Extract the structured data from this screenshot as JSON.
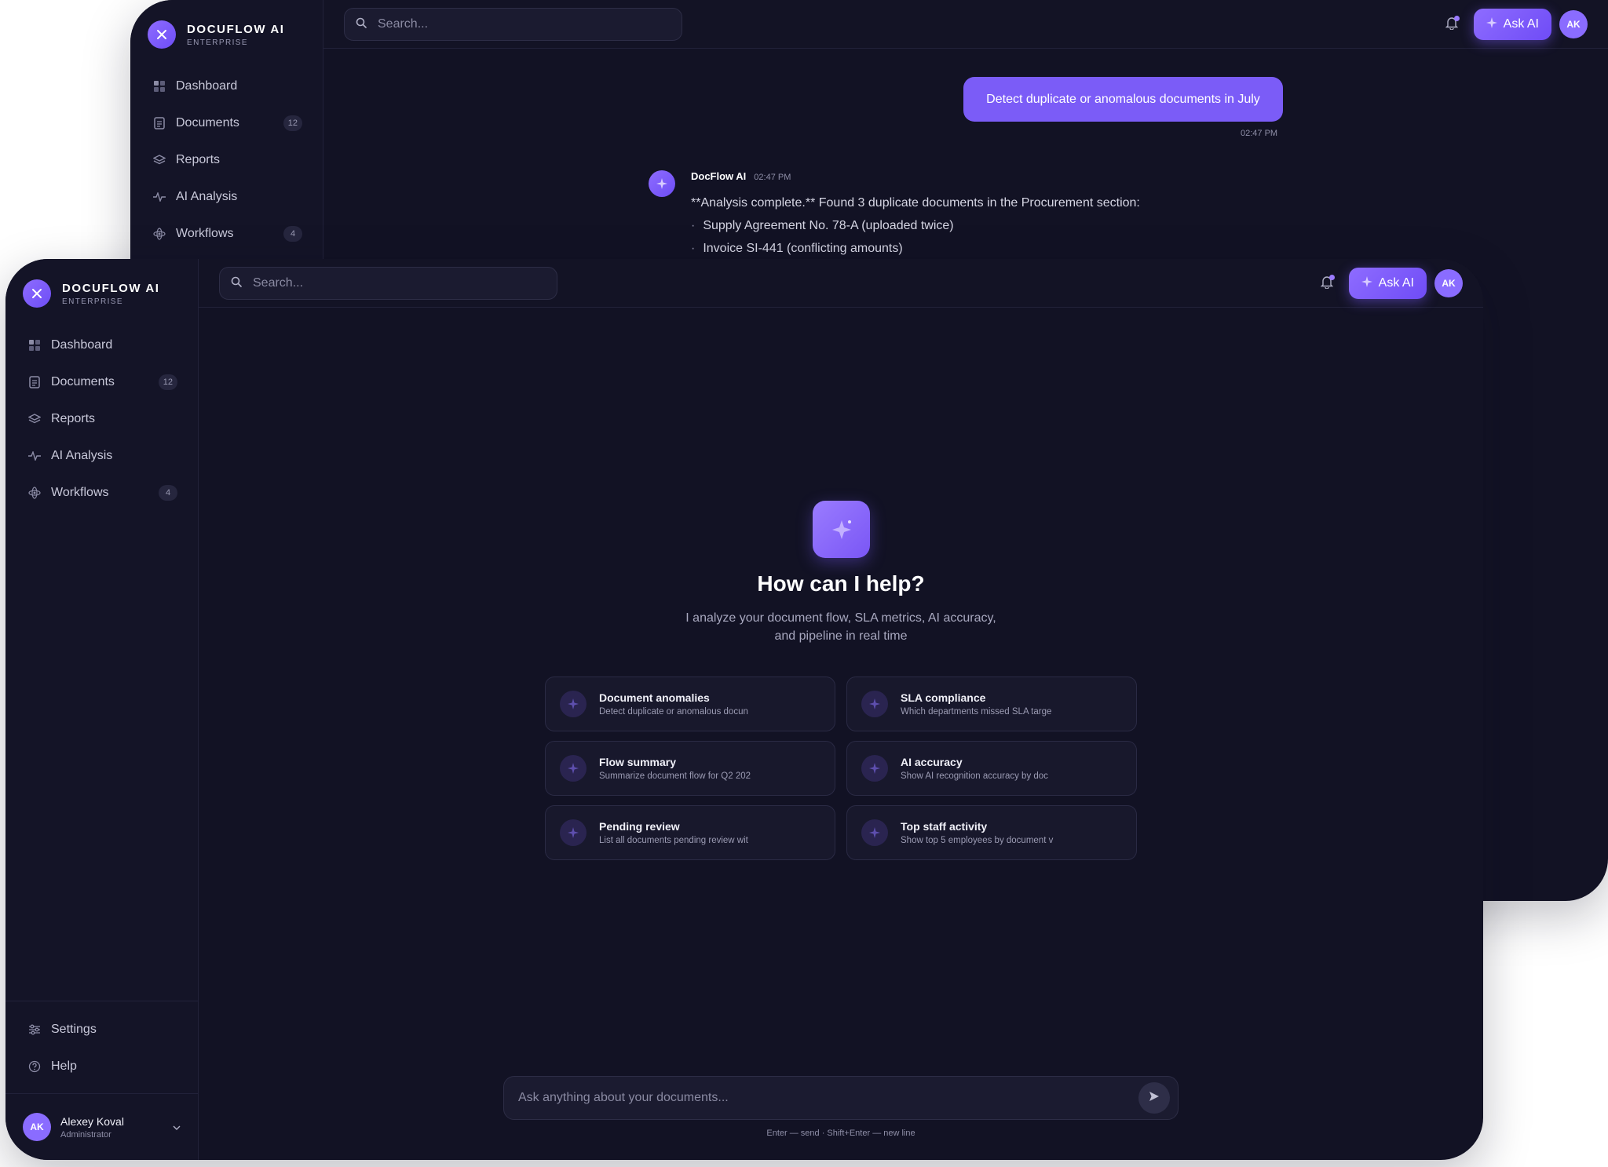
{
  "brand": {
    "name": "DOCUFLOW AI",
    "subtitle": "ENTERPRISE"
  },
  "nav": [
    {
      "label": "Dashboard",
      "icon": "grid-icon",
      "badge": null
    },
    {
      "label": "Documents",
      "icon": "document-icon",
      "badge": "12"
    },
    {
      "label": "Reports",
      "icon": "layers-icon",
      "badge": null
    },
    {
      "label": "AI Analysis",
      "icon": "pulse-icon",
      "badge": null
    },
    {
      "label": "Workflows",
      "icon": "atom-icon",
      "badge": "4"
    }
  ],
  "sidebar_bottom": [
    {
      "label": "Settings",
      "icon": "sliders-icon"
    },
    {
      "label": "Help",
      "icon": "help-circle-icon"
    }
  ],
  "user": {
    "initials": "AK",
    "name": "Alexey Koval",
    "role": "Administrator"
  },
  "topbar": {
    "search_placeholder": "Search...",
    "ask_ai_label": "Ask AI",
    "avatar_initials": "AK"
  },
  "chat": {
    "user_message": "Detect duplicate or anomalous documents in July",
    "user_time": "02:47 PM",
    "bot_name": "DocFlow AI",
    "bot_time": "02:47 PM",
    "bot_text": "**Analysis complete.** Found 3 duplicate documents in the Procurement section:",
    "bot_bullets": [
      "Supply Agreement No. 78-A (uploaded twice)",
      "Invoice SI-441 (conflicting amounts)"
    ]
  },
  "hero": {
    "title": "How can I help?",
    "subtitle_line1": "I analyze your document flow, SLA metrics, AI accuracy,",
    "subtitle_line2": "and pipeline in real time"
  },
  "suggestions": [
    {
      "title": "Document anomalies",
      "desc": "Detect duplicate or anomalous docun"
    },
    {
      "title": "SLA compliance",
      "desc": "Which departments missed SLA targe"
    },
    {
      "title": "Flow summary",
      "desc": "Summarize document flow for Q2 202"
    },
    {
      "title": "AI accuracy",
      "desc": "Show AI recognition accuracy by doc"
    },
    {
      "title": "Pending review",
      "desc": "List all documents pending review wit"
    },
    {
      "title": "Top staff activity",
      "desc": "Show top 5 employees by document v"
    }
  ],
  "composer": {
    "placeholder": "Ask anything about your documents...",
    "hint": "Enter — send · Shift+Enter — new line"
  },
  "colors": {
    "background": "#121224",
    "accent": "#7b5cf7",
    "surface": "#18182c"
  }
}
